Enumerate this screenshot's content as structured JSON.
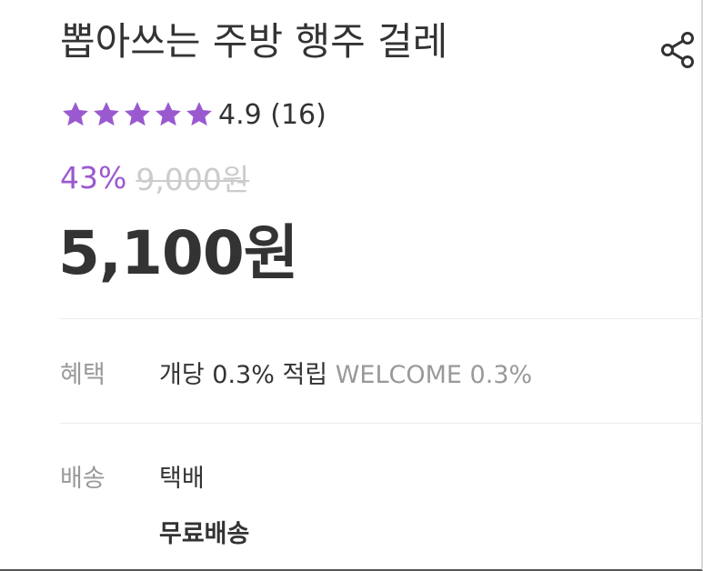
{
  "product": {
    "title": "뽑아쓰는 주방 행주 걸레"
  },
  "share": {
    "icon": "share-icon"
  },
  "rating": {
    "stars": 5,
    "max_stars": 5,
    "star_color": "#9b59d0",
    "text": "4.9 (16)"
  },
  "price": {
    "discount": "43%",
    "discount_color": "#9b59d0",
    "original": "9,000원",
    "sale": "5,100원"
  },
  "benefit": {
    "label": "혜택",
    "value": "개당 0.3% 적립",
    "extra": "WELCOME 0.3%"
  },
  "delivery": {
    "label": "배송",
    "method": "택배",
    "fee": "무료배송"
  }
}
